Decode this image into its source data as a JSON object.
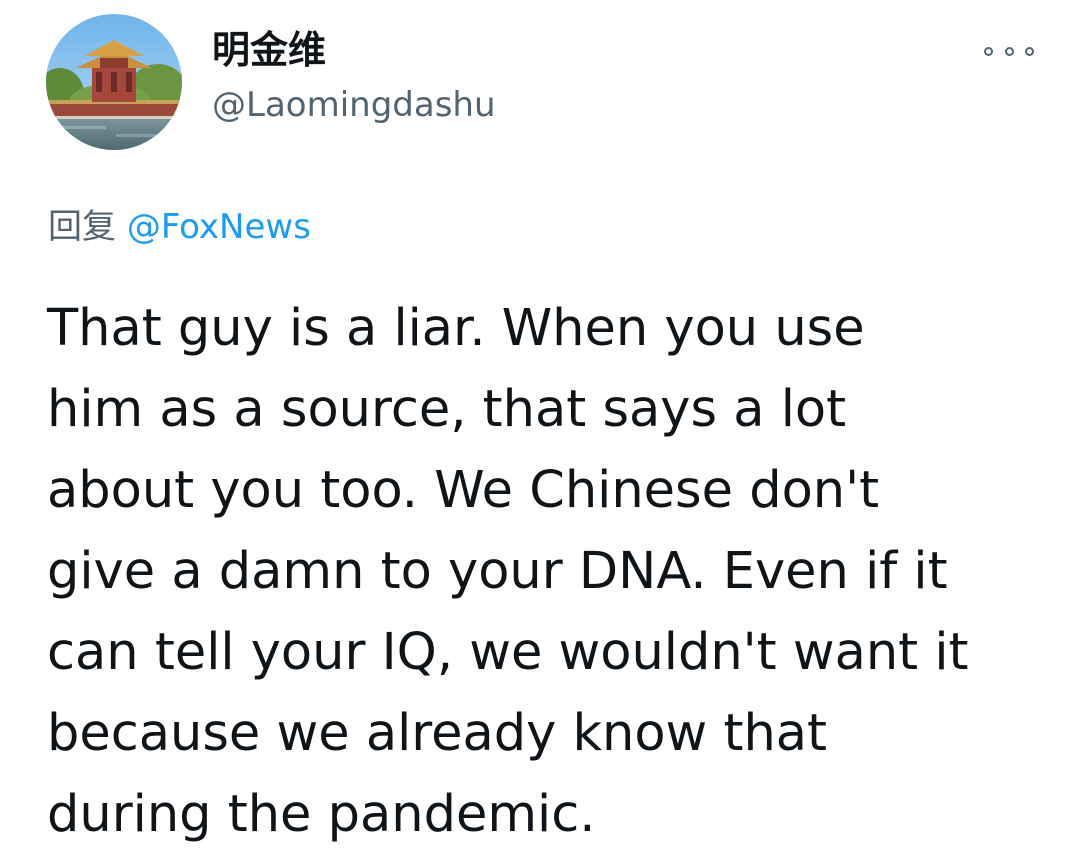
{
  "author": {
    "display_name": "明金维",
    "handle": "@Laomingdashu",
    "avatar_icon": "avatar-palace-photo"
  },
  "menu": {
    "icon": "more-options-icon"
  },
  "reply": {
    "prefix": "回复",
    "mention": "@FoxNews"
  },
  "tweet": {
    "lines": [
      "That guy is a liar. When you use",
      "him as a source, that says a lot",
      "about you too. We Chinese don't",
      "give a damn to your DNA. Even if it",
      "can tell your IQ, we wouldn't want it",
      "because we already know that",
      "during the pandemic."
    ]
  },
  "colors": {
    "text": "#0f1419",
    "secondary": "#536471",
    "link": "#1d9bf0",
    "background": "#ffffff"
  }
}
